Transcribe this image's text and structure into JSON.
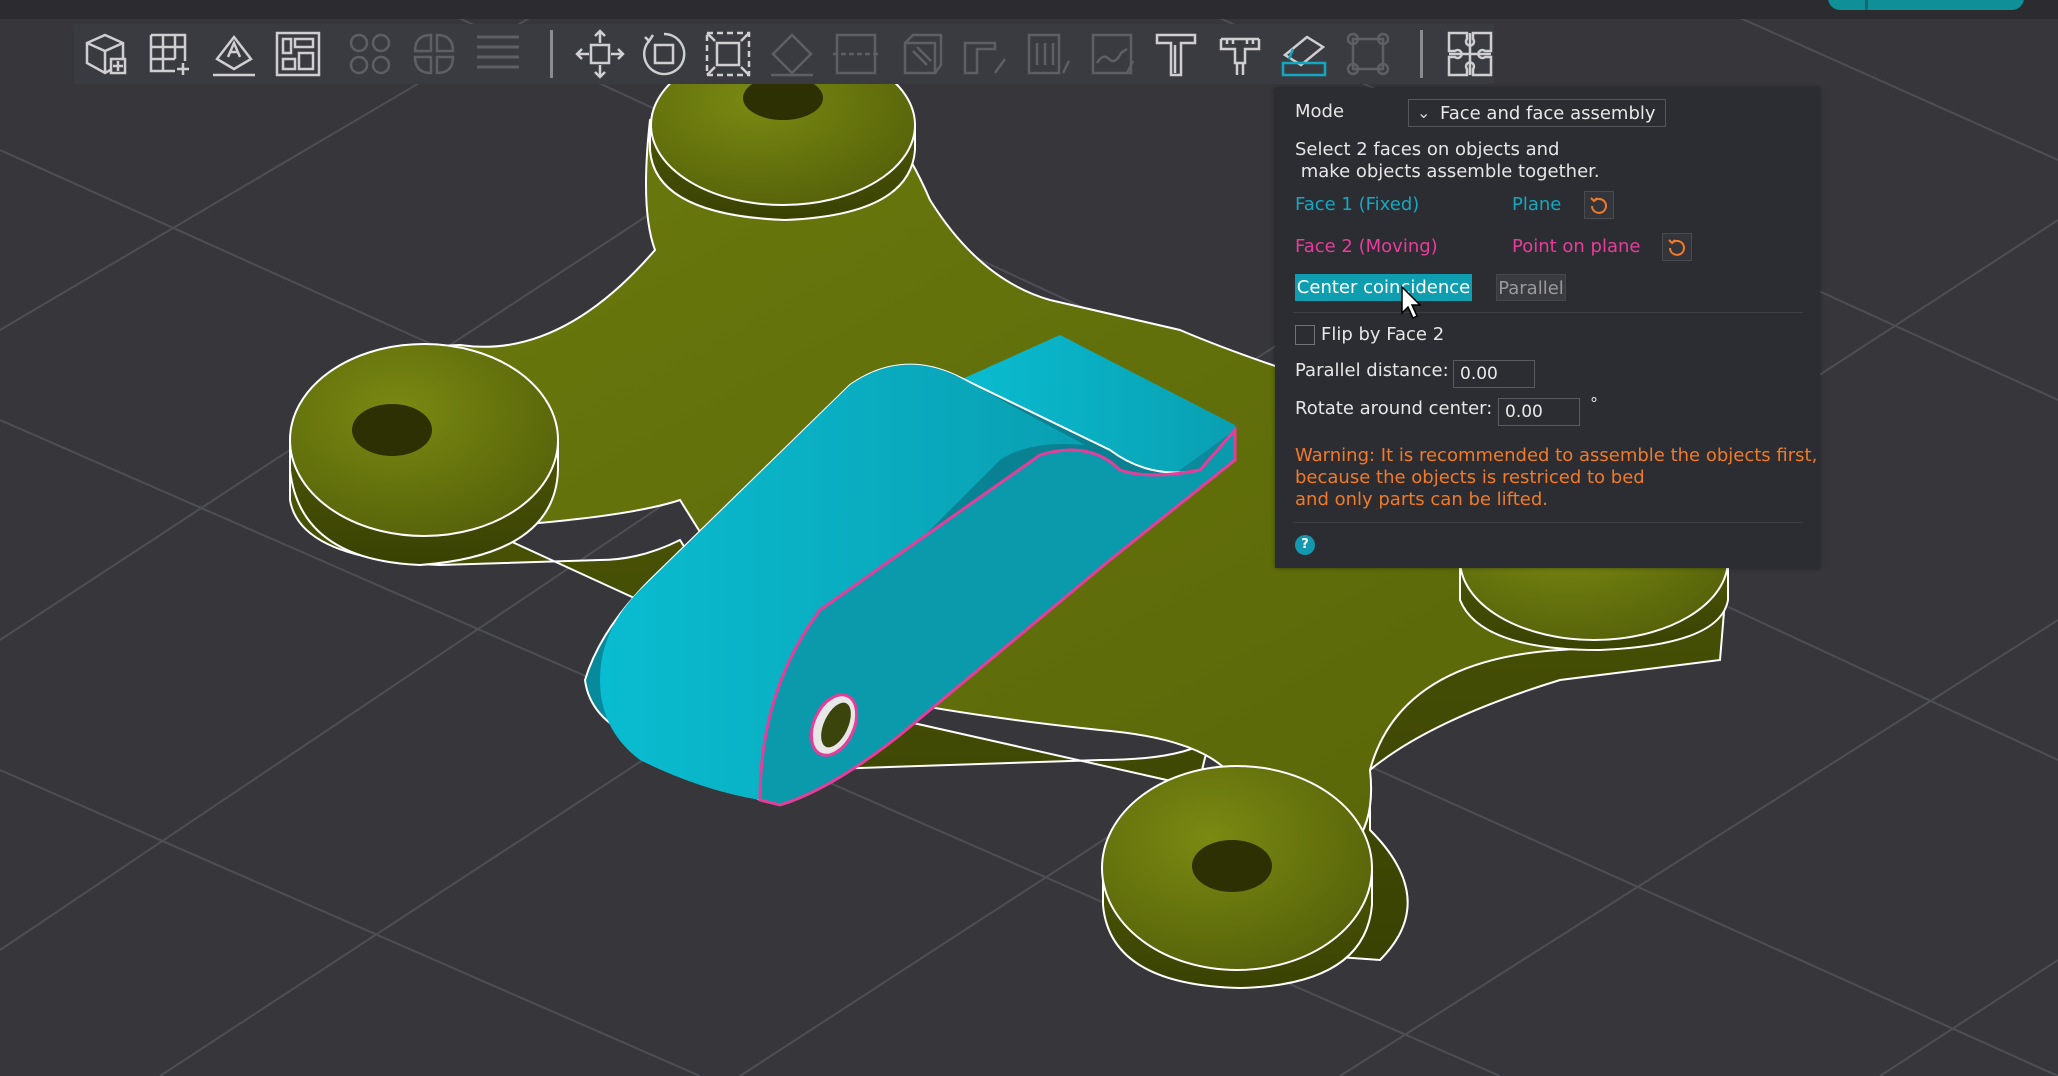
{
  "toolbar": {
    "icons": [
      "add-object-icon",
      "grid-add-icon",
      "text-emboss-icon",
      "arrange-icon",
      "split-objects-icon",
      "split-parts-icon",
      "layers-icon",
      "move-icon",
      "rotate-icon",
      "scale-icon",
      "lay-on-face-icon",
      "cut-icon",
      "paint-icon",
      "seam-icon",
      "supports-icon",
      "fuzzy-skin-icon",
      "text-icon",
      "measure-icon",
      "assembly-icon",
      "brim-ears-icon",
      "puzzle-icon"
    ]
  },
  "panel": {
    "mode_label": "Mode",
    "mode_value": "Face and face assembly",
    "instruction_line1": "Select 2 faces on objects and",
    "instruction_line2": " make objects assemble together.",
    "face1_label": "Face 1 (Fixed)",
    "face1_type": "Plane",
    "face2_label": "Face 2 (Moving)",
    "face2_type": "Point on plane",
    "center_coincidence": "Center coincidence",
    "parallel": "Parallel",
    "flip_label": "Flip by Face 2",
    "parallel_distance_label": "Parallel distance:",
    "parallel_distance_value": "0.00",
    "rotate_label": "Rotate around center:",
    "rotate_value": "0.00",
    "rotate_unit": "°",
    "warning_line1": "Warning: It is recommended to assemble the objects first,",
    "warning_line2": "because the objects is restriced to bed",
    "warning_line3": "and only parts can be lifted.",
    "help": "?"
  },
  "colors": {
    "background": "#36363b",
    "grid_line": "#4e4f55",
    "part_fixed": "#5e6a0a",
    "part_moving": "#0aa4b8",
    "face1_highlight": "#14a8c0",
    "face2_highlight": "#e73d9a",
    "warning": "#f07a28",
    "accent": "#0f9db0"
  }
}
